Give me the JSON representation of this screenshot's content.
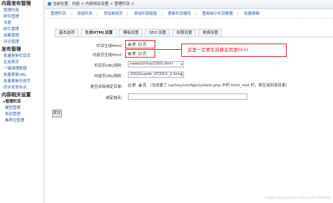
{
  "breadcrumb": "当前位置：内容 > 内容相关设置 > 管理栏目 >",
  "submenu": [
    "管理栏目",
    "添加栏目",
    "添加单网页",
    "添加外部链接",
    "更新栏目缓存",
    "重新统计栏目数据",
    "批量编辑"
  ],
  "sidebar": {
    "section1": "内容发布管理",
    "items1": [
      "管理内容",
      "附件管理",
      "专题",
      "碎片管理",
      "采集管理",
      "评论管理"
    ],
    "section2": "发布管理",
    "items2": [
      "批量更新栏目页",
      "生成首页",
      "一键清理数据",
      "批量更新URL",
      "批量更新内容页",
      "同步到发布点"
    ],
    "section3": "内容相关设置",
    "active_item": "管理栏目",
    "items3": [
      "模型管理",
      "类别管理",
      "推荐位管理"
    ]
  },
  "tabs": [
    "基本选项",
    "生成HTML设置",
    "模板设置",
    "SEO 设置",
    "权限设置",
    "收费设置"
  ],
  "active_tab_index": 1,
  "form": {
    "row1_label": "栏目生成Html：",
    "row2_label": "内容页生成Html：",
    "row3_label": "栏目页URL规则：",
    "row4_label": "内容页URL规则：",
    "row5_label": "是否去除绑定目录：",
    "row6_label": "绑定域名：",
    "yes": "是",
    "no": "否",
    "row3_value": "news/china/1000.html",
    "row4_value": "2010/catdir_0720/1_2.html",
    "row5_note": "（当设置了 caches/configs/system.php 中的 html_root 时，将生成到该目录）"
  },
  "callout_text": "这里一定要生成静态页面html",
  "submit_label": "提交",
  "watermark": "https://blog.csdn.net/u_42764049"
}
